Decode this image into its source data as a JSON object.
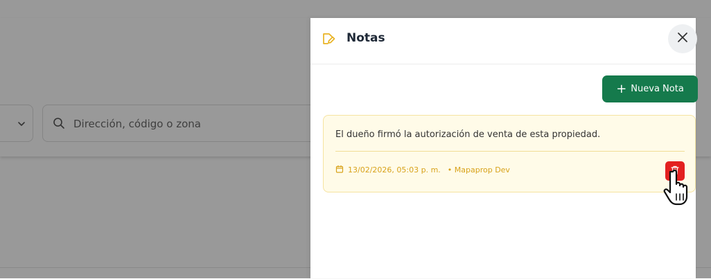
{
  "background": {
    "search_placeholder": "Dirección, código o zona"
  },
  "drawer": {
    "title": "Notas",
    "close_label": "Cerrar",
    "new_note_label": "Nueva Nota",
    "notes": [
      {
        "text": "El dueño firmó la autorización de venta de esta propiedad.",
        "date": "13/02/2026, 05:03 p. m.",
        "author": "• Mapaprop Dev"
      }
    ]
  },
  "colors": {
    "accent_green": "#157a4c",
    "note_bg": "#fffbe8",
    "note_meta": "#d8a21a",
    "delete_red": "#e32020"
  }
}
